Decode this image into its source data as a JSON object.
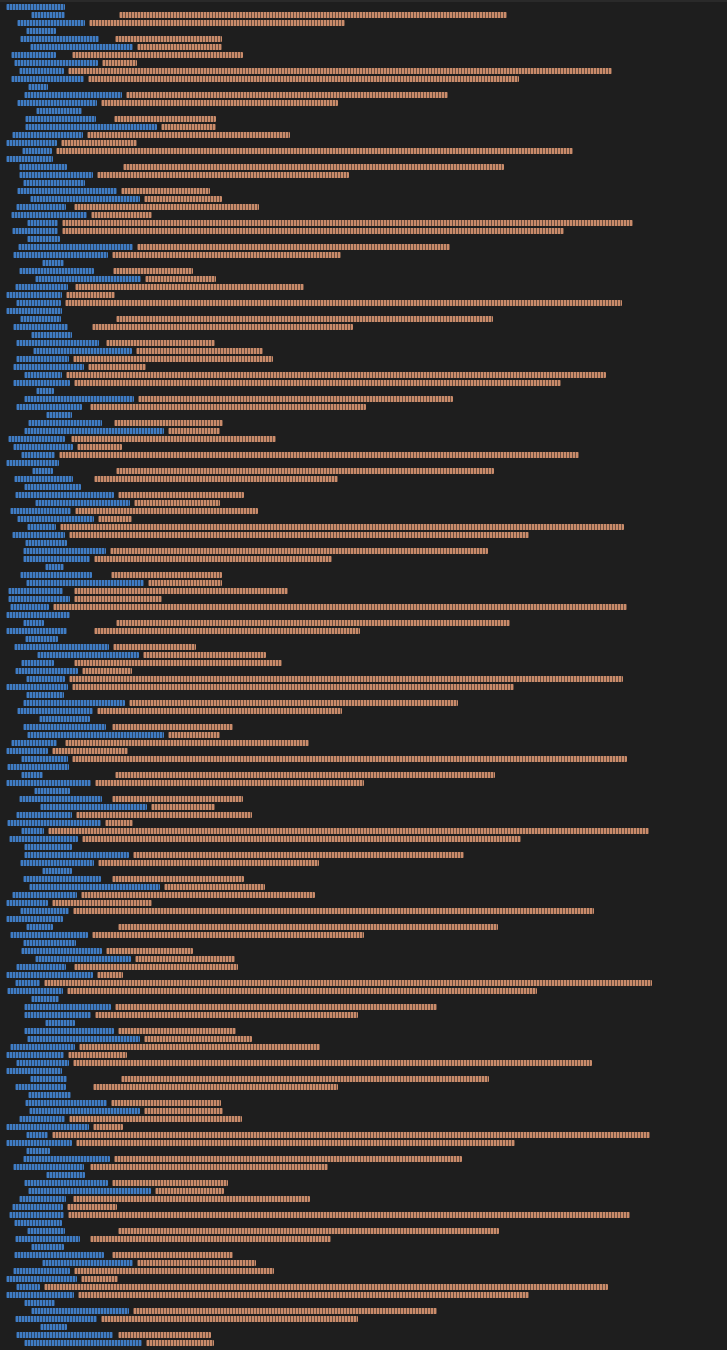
{
  "editor": {
    "theme": "dark",
    "colors": {
      "background": "#1e1e1e",
      "identifier": "#3f7cc4",
      "string": "#c98b6a"
    },
    "note_visible_text": ""
  }
}
